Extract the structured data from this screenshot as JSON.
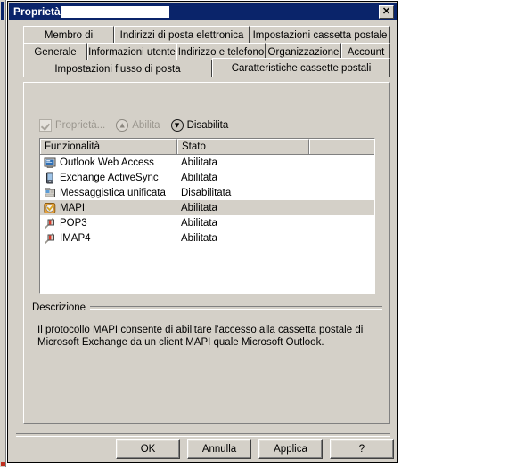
{
  "window": {
    "title": "Proprietà",
    "title_redacted": true,
    "close_label": "✕"
  },
  "tabs": {
    "row1": [
      {
        "label": "Membro di",
        "active": false
      },
      {
        "label": "Indirizzi di posta elettronica",
        "active": false
      },
      {
        "label": "Impostazioni cassetta postale",
        "active": false
      }
    ],
    "row2": [
      {
        "label": "Generale",
        "active": false
      },
      {
        "label": "Informazioni utente",
        "active": false
      },
      {
        "label": "Indirizzo e telefono",
        "active": false
      },
      {
        "label": "Organizzazione",
        "active": false
      },
      {
        "label": "Account",
        "active": false
      }
    ],
    "row3": [
      {
        "label": "Impostazioni flusso di posta",
        "active": false
      },
      {
        "label": "Caratteristiche cassette postali",
        "active": true
      }
    ]
  },
  "toolbar": {
    "properties_label": "Proprietà...",
    "enable_label": "Abilita",
    "disable_label": "Disabilita",
    "properties_enabled": false,
    "enable_enabled": false,
    "disable_enabled": true
  },
  "list": {
    "columns": [
      "Funzionalità",
      "Stato",
      ""
    ],
    "rows": [
      {
        "icon": "monitor-icon",
        "name": "Outlook Web Access",
        "state": "Abilitata",
        "selected": false
      },
      {
        "icon": "mobile-device-icon",
        "name": "Exchange ActiveSync",
        "state": "Abilitata",
        "selected": false
      },
      {
        "icon": "fax-machine-icon",
        "name": "Messaggistica unificata",
        "state": "Disabilitata",
        "selected": false
      },
      {
        "icon": "outlook-mapi-icon",
        "name": "MAPI",
        "state": "Abilitata",
        "selected": true
      },
      {
        "icon": "plug-icon",
        "name": "POP3",
        "state": "Abilitata",
        "selected": false
      },
      {
        "icon": "plug-icon",
        "name": "IMAP4",
        "state": "Abilitata",
        "selected": false
      }
    ]
  },
  "description": {
    "legend": "Descrizione",
    "text": "Il protocollo MAPI consente di abilitare l'accesso alla cassetta postale di Microsoft Exchange da un client MAPI quale Microsoft Outlook."
  },
  "buttons": [
    {
      "label": "OK"
    },
    {
      "label": "Annulla"
    },
    {
      "label": "Applica"
    },
    {
      "label": "?"
    }
  ],
  "annotation": {
    "type": "left-pointing-arrow",
    "target": "Disabilita",
    "color": "#000000"
  },
  "colors": {
    "titlebar": "#0a246a",
    "face": "#d4d0c8",
    "selection": "#d4d0c8",
    "list_background": "#ffffff"
  }
}
